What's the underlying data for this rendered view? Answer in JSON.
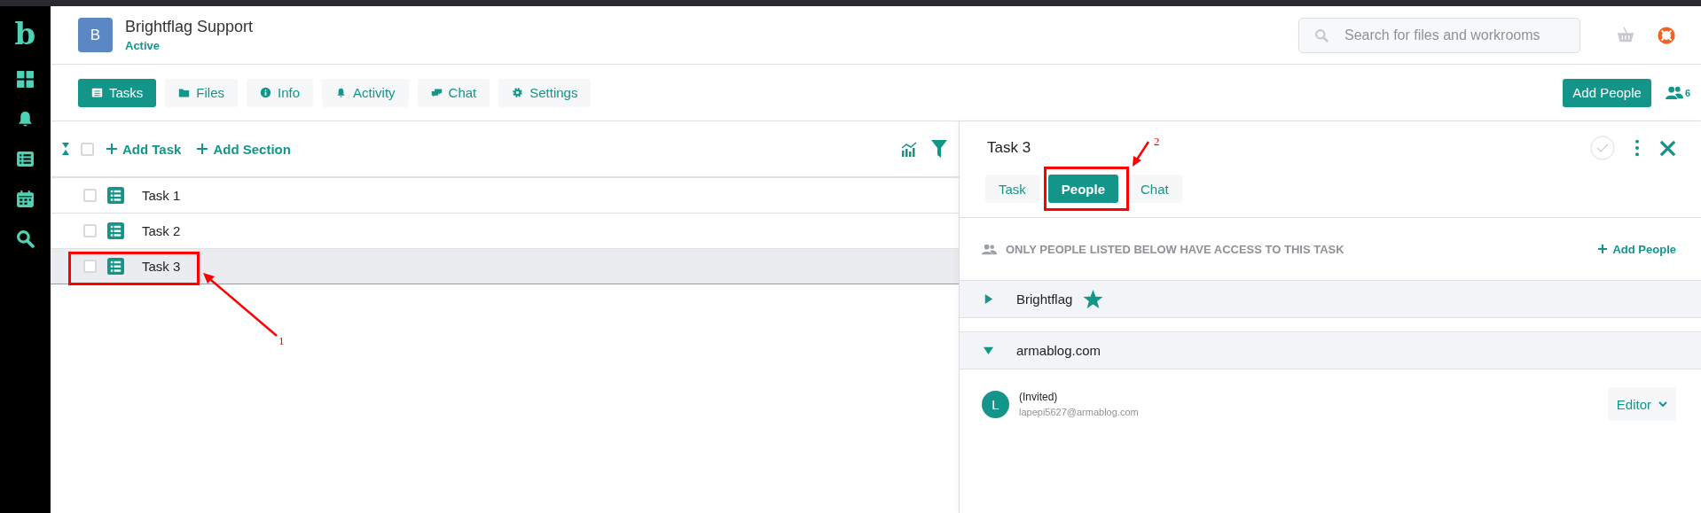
{
  "sidebar": {
    "logo": "b"
  },
  "header": {
    "avatar_letter": "B",
    "title": "Brightflag Support",
    "status": "Active",
    "search": {
      "placeholder": "Search for files and workrooms"
    }
  },
  "tabs": [
    {
      "label": "Tasks",
      "selected": true
    },
    {
      "label": "Files",
      "selected": false
    },
    {
      "label": "Info",
      "selected": false
    },
    {
      "label": "Activity",
      "selected": false
    },
    {
      "label": "Chat",
      "selected": false
    },
    {
      "label": "Settings",
      "selected": false
    }
  ],
  "add_people_button": "Add People",
  "people_count": "6",
  "toolbar": {
    "select_all_checked": false,
    "add_task": "Add Task",
    "add_section": "Add Section"
  },
  "tasks": [
    {
      "title": "Task 1",
      "checked": false,
      "selected": false
    },
    {
      "title": "Task 2",
      "checked": false,
      "selected": false
    },
    {
      "title": "Task 3",
      "checked": false,
      "selected": true
    }
  ],
  "detail": {
    "title": "Task 3",
    "tabs": [
      {
        "label": "Task",
        "selected": false
      },
      {
        "label": "People",
        "selected": true
      },
      {
        "label": "Chat",
        "selected": false
      }
    ],
    "notice": "ONLY PEOPLE LISTED BELOW HAVE ACCESS TO THIS TASK",
    "add_people": "Add People",
    "groups": [
      {
        "name": "Brightflag",
        "starred": true,
        "expanded": false
      },
      {
        "name": "armablog.com",
        "starred": false,
        "expanded": true,
        "members": [
          {
            "initial": "L",
            "name": "(Invited)",
            "email": "lapepi5627@armablog.com",
            "role": "Editor"
          }
        ]
      }
    ]
  },
  "annotations": [
    {
      "label": "1"
    },
    {
      "label": "2"
    }
  ]
}
